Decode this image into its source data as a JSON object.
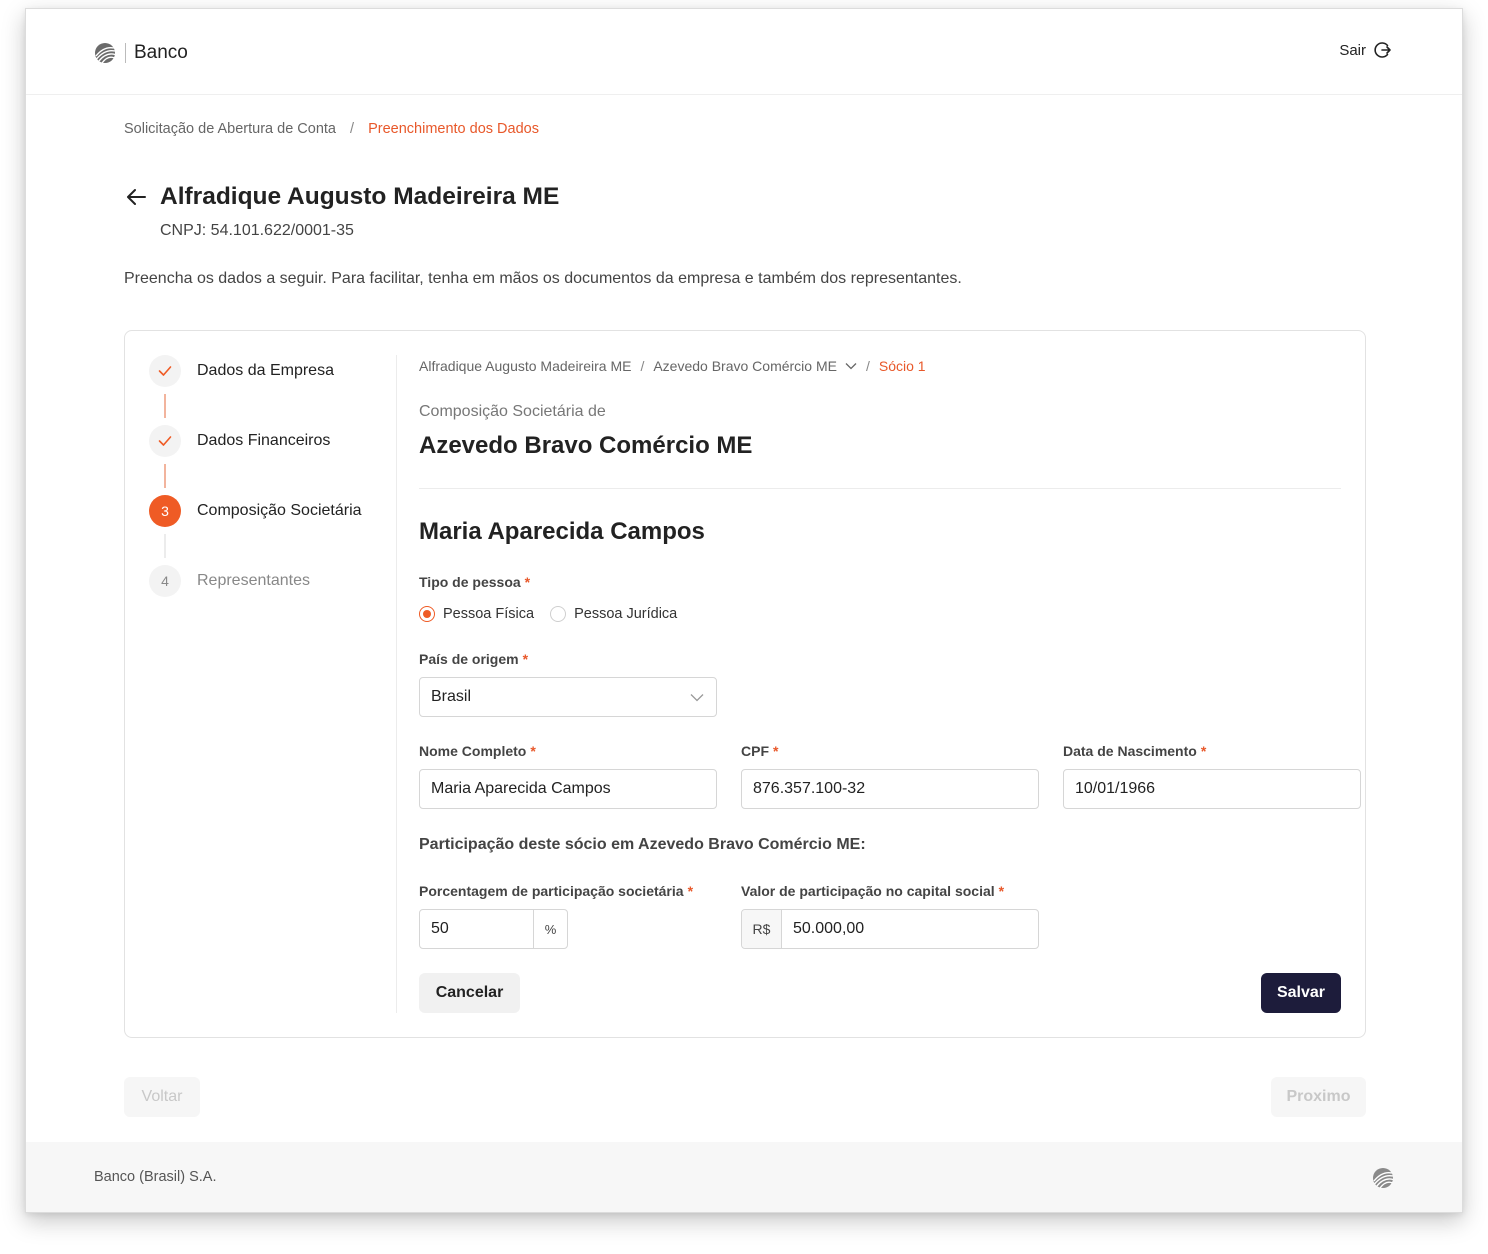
{
  "header": {
    "brand": "Banco",
    "logout_label": "Sair"
  },
  "breadcrumb": {
    "items": [
      "Solicitação de Abertura de Conta",
      "Preenchimento dos Dados"
    ],
    "separator": "/"
  },
  "page": {
    "title": "Alfradique Augusto Madeireira ME",
    "cnpj": "CNPJ: 54.101.622/0001-35",
    "intro": "Preencha os dados a seguir. Para facilitar, tenha em mãos os documentos da empresa e também dos representantes."
  },
  "steps": [
    {
      "number": "",
      "label": "Dados da Empresa",
      "state": "done"
    },
    {
      "number": "",
      "label": "Dados Financeiros",
      "state": "done"
    },
    {
      "number": "3",
      "label": "Composição Societária",
      "state": "current"
    },
    {
      "number": "4",
      "label": "Representantes",
      "state": "todo"
    }
  ],
  "inner_breadcrumb": {
    "items": [
      "Alfradique Augusto Madeireira ME",
      "Azevedo Bravo Comércio ME",
      "Sócio 1"
    ],
    "separator": "/"
  },
  "form": {
    "subheading": "Composição Societária de",
    "company": "Azevedo Bravo Comércio ME",
    "partner_name": "Maria Aparecida Campos",
    "person_type": {
      "label": "Tipo de pessoa",
      "options": [
        "Pessoa Física",
        "Pessoa Jurídica"
      ],
      "selected": "Pessoa Física"
    },
    "country": {
      "label": "País de origem",
      "value": "Brasil"
    },
    "full_name": {
      "label": "Nome Completo",
      "value": "Maria Aparecida Campos"
    },
    "cpf": {
      "label": "CPF",
      "value": "876.357.100-32"
    },
    "birth_date": {
      "label": "Data de Nascimento",
      "value": "10/01/1966"
    },
    "participation_heading": "Participação deste sócio em Azevedo Bravo Comércio ME:",
    "percentage": {
      "label": "Porcentagem de participação societária",
      "value": "50",
      "suffix": "%"
    },
    "capital": {
      "label": "Valor de participação no capital social",
      "prefix": "R$",
      "value": "50.000,00"
    },
    "required_mark": "*",
    "cancel_label": "Cancelar",
    "save_label": "Salvar"
  },
  "nav": {
    "back_label": "Voltar",
    "next_label": "Proximo"
  },
  "footer": {
    "text": "Banco (Brasil) S.A."
  },
  "colors": {
    "accent": "#ef5b25",
    "primary_dark": "#1d1c3b"
  },
  "icons": [
    "bank-logo-icon",
    "logout-icon",
    "back-arrow-icon",
    "check-icon",
    "chevron-down-icon"
  ]
}
